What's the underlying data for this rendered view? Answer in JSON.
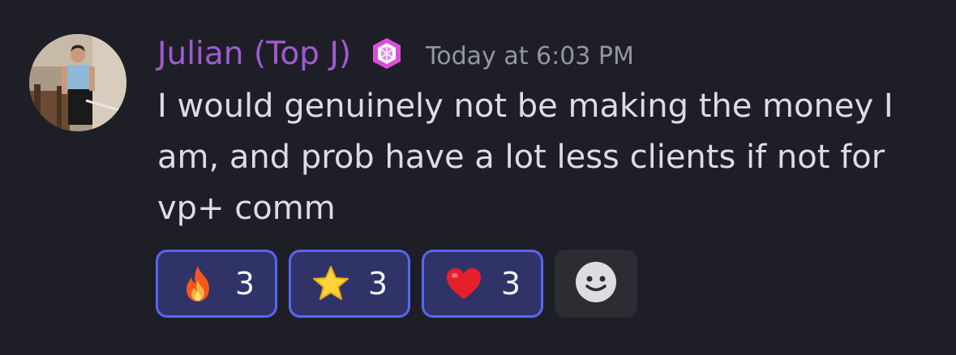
{
  "message": {
    "author": "Julian (Top J)",
    "timestamp": "Today at 6:03 PM",
    "content_lines": [
      "I would genuinely not be making the money I",
      "am, and prob have a lot less clients if not for",
      "vp+ comm"
    ],
    "author_color": "#a05bd0",
    "role_icon": "pink-cube-role-icon"
  },
  "reactions": [
    {
      "emoji": "fire-icon",
      "count": "3"
    },
    {
      "emoji": "star-icon",
      "count": "3"
    },
    {
      "emoji": "heart-icon",
      "count": "3"
    }
  ],
  "add_reaction_icon": "smiley-face-icon",
  "colors": {
    "background": "#1e1f26",
    "reaction_border": "#5865f2",
    "reaction_fill": "#2f3368"
  }
}
